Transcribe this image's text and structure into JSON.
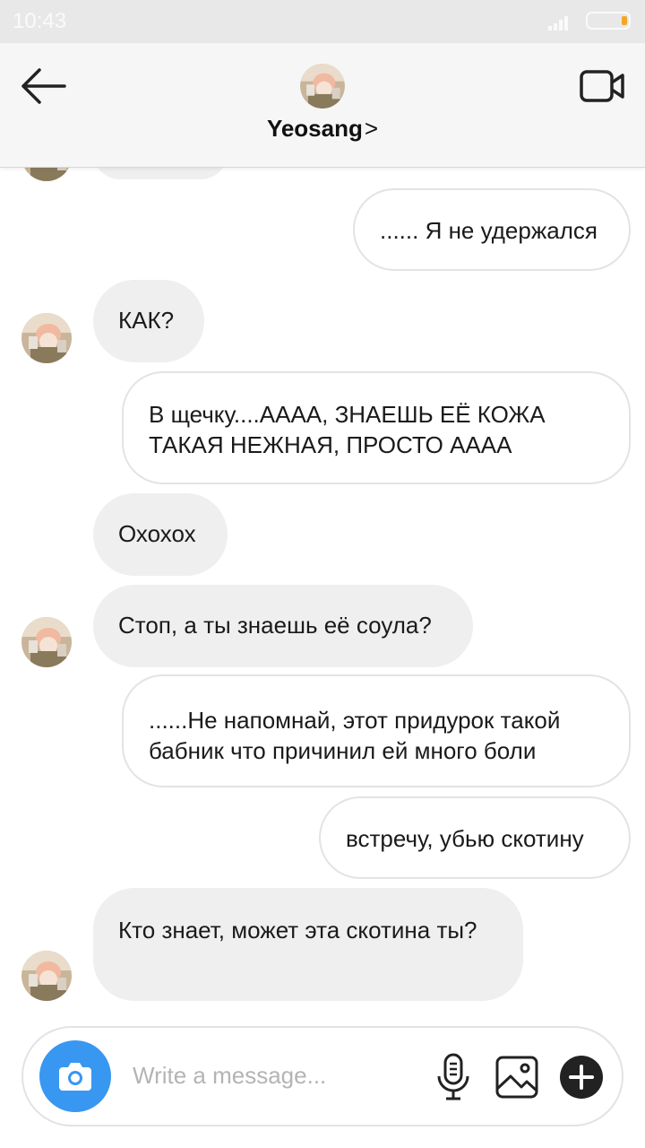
{
  "status_bar": {
    "time": "10:43"
  },
  "header": {
    "contact_name": "Yeosang",
    "chevron": ">"
  },
  "messages": [
    {
      "sender": "me",
      "text": "...... Я не удержался"
    },
    {
      "sender": "contact",
      "text": "КАК?"
    },
    {
      "sender": "me",
      "text": "В щечку....АААА, ЗНАЕШЬ ЕЁ КОЖА ТАКАЯ НЕЖНАЯ, ПРОСТО АААА"
    },
    {
      "sender": "contact",
      "text": "Охохох"
    },
    {
      "sender": "contact",
      "text": "Стоп, а ты знаешь её соула?"
    },
    {
      "sender": "me",
      "text": "......Не напомнай, этот придурок такой бабник что причинил ей много боли"
    },
    {
      "sender": "me",
      "text": "встречу, убью скотину"
    },
    {
      "sender": "contact",
      "text": "Кто знает, может эта скотина ты?"
    }
  ],
  "composer": {
    "placeholder": "Write a message..."
  },
  "colors": {
    "accent": "#3897f0",
    "incoming_bubble": "#efefef",
    "outgoing_border": "#e3e3e3",
    "battery": "#f5a623"
  },
  "icons": [
    "back-arrow-icon",
    "video-call-icon",
    "camera-icon",
    "microphone-icon",
    "gallery-icon",
    "plus-icon"
  ]
}
